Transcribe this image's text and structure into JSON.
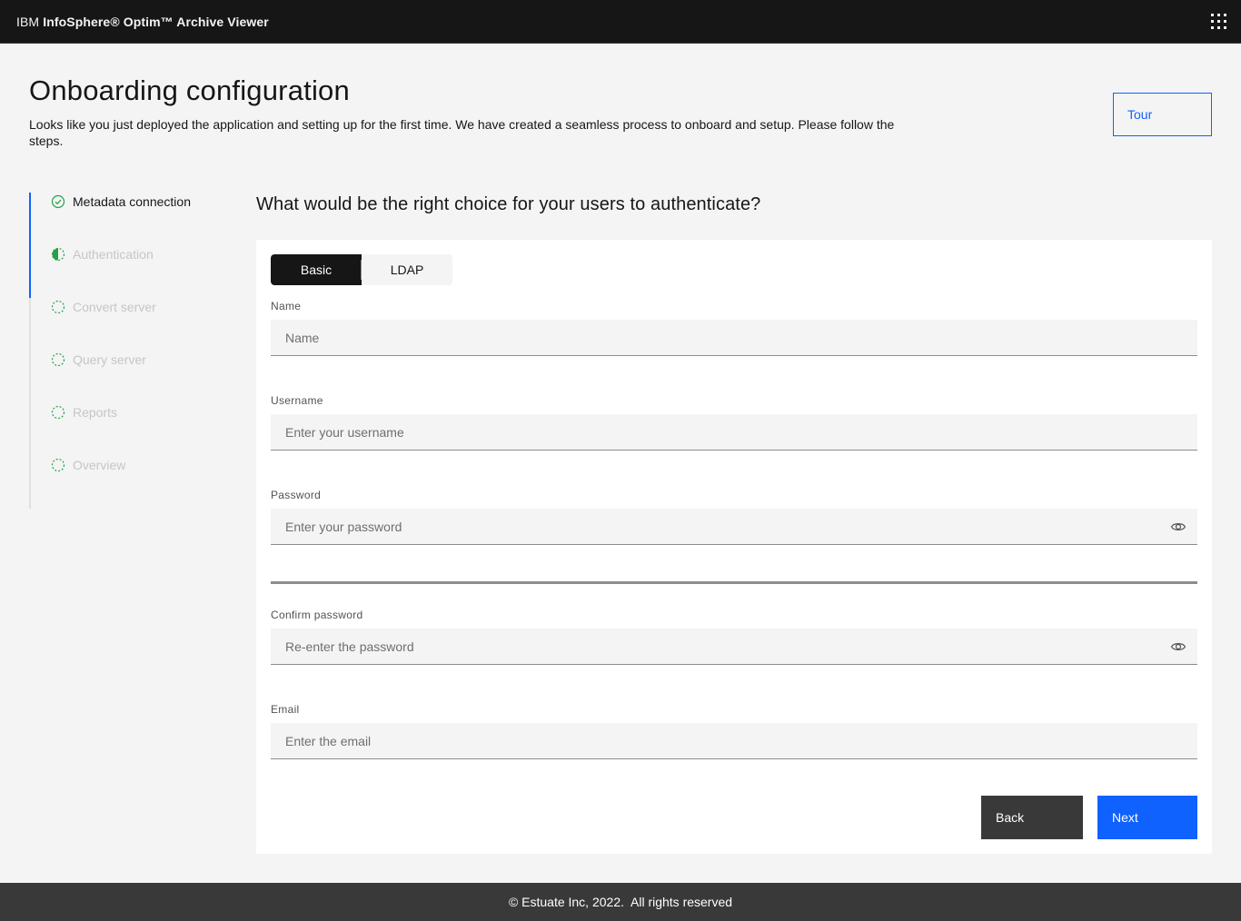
{
  "header": {
    "brand_prefix": "IBM",
    "product_name": "InfoSphere® Optim™ Archive Viewer",
    "app_switcher_icon": "app-switcher-grid-icon"
  },
  "page": {
    "title": "Onboarding configuration",
    "description": "Looks like you just deployed the application and setting up for the first time. We have created a seamless process to onboard and setup. Please follow the steps.",
    "tour_label": "Tour"
  },
  "progress": {
    "steps": [
      {
        "label": "Metadata connection",
        "state": "complete"
      },
      {
        "label": "Authentication",
        "state": "current"
      },
      {
        "label": "Convert server",
        "state": "incomplete"
      },
      {
        "label": "Query server",
        "state": "incomplete"
      },
      {
        "label": "Reports",
        "state": "incomplete"
      },
      {
        "label": "Overview",
        "state": "incomplete"
      }
    ]
  },
  "form": {
    "question": "What would be the right choice for your users to authenticate?",
    "switch": {
      "options": [
        "Basic",
        "LDAP"
      ],
      "selected": "Basic"
    },
    "fields": {
      "name": {
        "label": "Name",
        "placeholder": "Name",
        "value": ""
      },
      "username": {
        "label": "Username",
        "placeholder": "Enter your username",
        "value": ""
      },
      "password": {
        "label": "Password",
        "placeholder": "Enter your password",
        "value": ""
      },
      "confirm_password": {
        "label": "Confirm password",
        "placeholder": "Re-enter the password",
        "value": ""
      },
      "email": {
        "label": "Email",
        "placeholder": "Enter the email",
        "value": ""
      }
    },
    "back_label": "Back",
    "next_label": "Next"
  },
  "footer": {
    "text": "© Estuate Inc, 2022.  All rights reserved"
  },
  "colors": {
    "accent": "#0f62fe",
    "complete": "#24a148",
    "header_bg": "#161616",
    "footer_bg": "#393939"
  }
}
